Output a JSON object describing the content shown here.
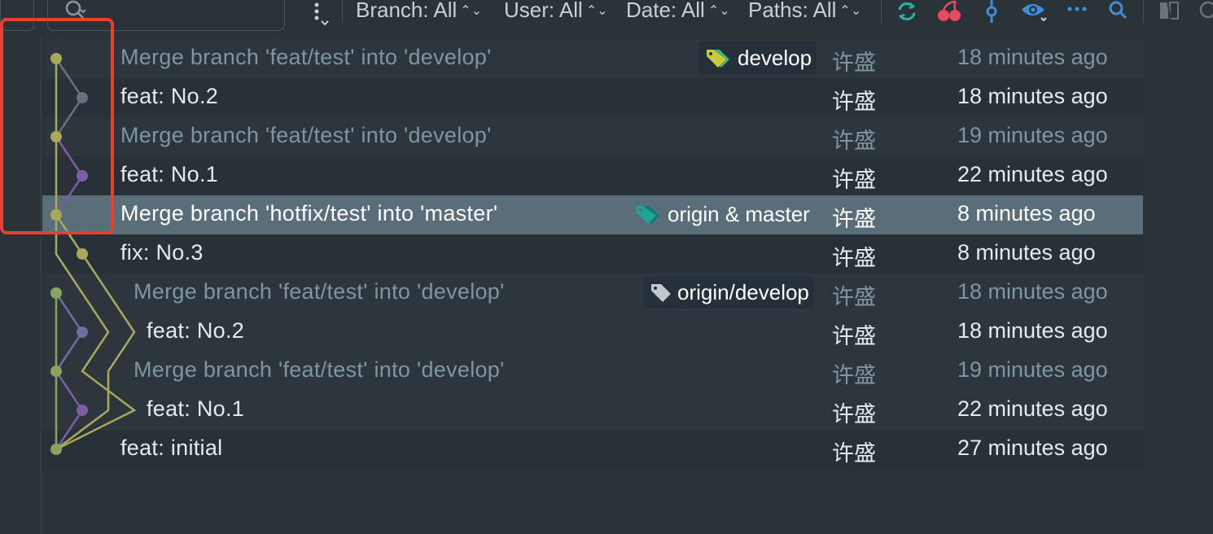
{
  "toolbar": {
    "filters": [
      {
        "label": "Branch: All"
      },
      {
        "label": "User: All"
      },
      {
        "label": "Date: All"
      },
      {
        "label": "Paths: All"
      }
    ]
  },
  "commits": [
    {
      "subject": "Merge branch 'feat/test' into 'develop'",
      "author": "许盛",
      "date": "18 minutes ago",
      "dim": true,
      "ref": "develop",
      "ref_icon": "tag-yellow-green-icon"
    },
    {
      "subject": "feat: No.2",
      "author": "许盛",
      "date": "18 minutes ago",
      "dim": false
    },
    {
      "subject": "Merge branch 'feat/test' into 'develop'",
      "author": "许盛",
      "date": "19 minutes ago",
      "dim": true
    },
    {
      "subject": "feat: No.1",
      "author": "许盛",
      "date": "22 minutes ago",
      "dim": false
    },
    {
      "subject": "Merge branch 'hotfix/test' into 'master'",
      "author": "许盛",
      "date": "8 minutes ago",
      "dim": false,
      "selected": true,
      "ref": "origin & master",
      "ref_icon": "tag-teal-icon"
    },
    {
      "subject": "fix: No.3",
      "author": "许盛",
      "date": "8 minutes ago",
      "dim": false
    },
    {
      "subject": "Merge branch 'feat/test' into 'develop'",
      "author": "许盛",
      "date": "18 minutes ago",
      "dim": true,
      "ref": "origin/develop",
      "ref_icon": "tag-gray-icon"
    },
    {
      "subject": "feat: No.2",
      "author": "许盛",
      "date": "18 minutes ago",
      "dim": false
    },
    {
      "subject": "Merge branch 'feat/test' into 'develop'",
      "author": "许盛",
      "date": "19 minutes ago",
      "dim": true
    },
    {
      "subject": "feat: No.1",
      "author": "许盛",
      "date": "22 minutes ago",
      "dim": false
    },
    {
      "subject": "feat: initial",
      "author": "许盛",
      "date": "27 minutes ago",
      "dim": false
    }
  ],
  "colors": {
    "accent_blue": "#3d8fd9",
    "highlight_red": "#e8402f",
    "graph_yellow": "#a9a95c",
    "graph_purple": "#7b5ea3",
    "graph_gray": "#6b6f7d",
    "graph_green": "#8aa35c"
  }
}
